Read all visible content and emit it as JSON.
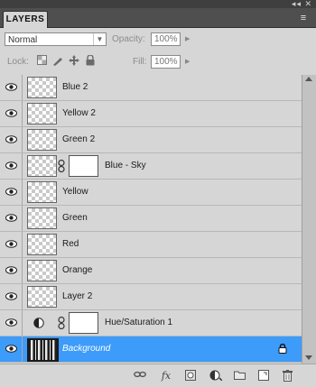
{
  "panel": {
    "tab_label": "LAYERS",
    "window_controls": "◂◂ ✕",
    "menu_icon": "≡"
  },
  "options": {
    "blend_mode": "Normal",
    "opacity_label": "Opacity:",
    "opacity_value": "100%",
    "lock_label": "Lock:",
    "fill_label": "Fill:",
    "fill_value": "100%",
    "lock_icons": [
      "lock-transparent-icon",
      "lock-image-icon",
      "lock-position-icon",
      "lock-all-icon"
    ]
  },
  "layers": [
    {
      "name": "Blue 2",
      "kind": "pixel"
    },
    {
      "name": "Yellow 2",
      "kind": "pixel"
    },
    {
      "name": "Green 2",
      "kind": "pixel"
    },
    {
      "name": "Blue - Sky",
      "kind": "masked"
    },
    {
      "name": "Yellow",
      "kind": "pixel"
    },
    {
      "name": "Green",
      "kind": "pixel"
    },
    {
      "name": "Red",
      "kind": "pixel"
    },
    {
      "name": "Orange",
      "kind": "pixel"
    },
    {
      "name": "Layer 2",
      "kind": "pixel"
    },
    {
      "name": "Hue/Saturation 1",
      "kind": "adjustment"
    },
    {
      "name": "Background",
      "kind": "background",
      "selected": true,
      "locked": true
    }
  ],
  "bottom_icons": [
    "link-layers-icon",
    "fx-icon",
    "add-mask-icon",
    "adjustment-layer-icon",
    "new-group-icon",
    "new-layer-icon",
    "trash-icon"
  ],
  "colors": {
    "selected_row": "#3d9bfa",
    "panel_bg": "#d6d6d6"
  }
}
